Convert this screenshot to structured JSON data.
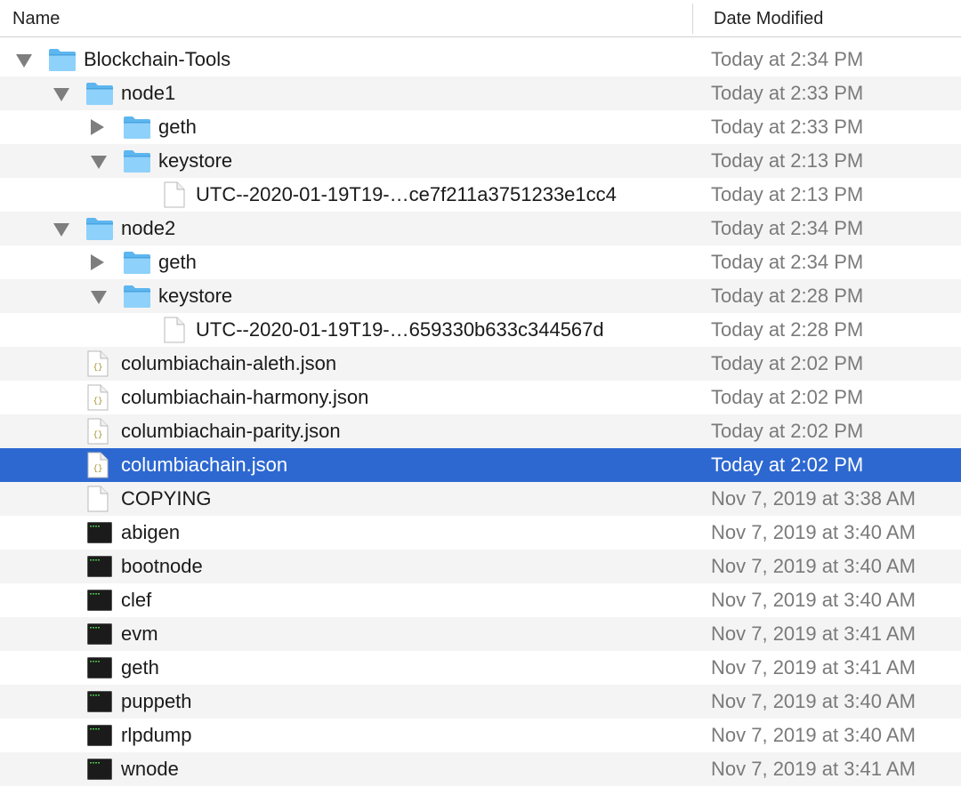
{
  "header": {
    "name_label": "Name",
    "date_label": "Date Modified"
  },
  "rows": [
    {
      "name": "Blockchain-Tools",
      "date": "Today at 2:34 PM",
      "icon": "folder-icon",
      "disclosure": "expanded"
    },
    {
      "name": "node1",
      "date": "Today at 2:33 PM",
      "icon": "folder-icon",
      "disclosure": "expanded"
    },
    {
      "name": "geth",
      "date": "Today at 2:33 PM",
      "icon": "folder-icon",
      "disclosure": "collapsed"
    },
    {
      "name": "keystore",
      "date": "Today at 2:13 PM",
      "icon": "folder-icon",
      "disclosure": "expanded"
    },
    {
      "name": "UTC--2020-01-19T19-…ce7f211a3751233e1cc4",
      "date": "Today at 2:13 PM",
      "icon": "document-icon"
    },
    {
      "name": "node2",
      "date": "Today at 2:34 PM",
      "icon": "folder-icon",
      "disclosure": "expanded"
    },
    {
      "name": "geth",
      "date": "Today at 2:34 PM",
      "icon": "folder-icon",
      "disclosure": "collapsed"
    },
    {
      "name": "keystore",
      "date": "Today at 2:28 PM",
      "icon": "folder-icon",
      "disclosure": "expanded"
    },
    {
      "name": "UTC--2020-01-19T19-…659330b633c344567d",
      "date": "Today at 2:28 PM",
      "icon": "document-icon"
    },
    {
      "name": "columbiachain-aleth.json",
      "date": "Today at 2:02 PM",
      "icon": "json-file-icon"
    },
    {
      "name": "columbiachain-harmony.json",
      "date": "Today at 2:02 PM",
      "icon": "json-file-icon"
    },
    {
      "name": "columbiachain-parity.json",
      "date": "Today at 2:02 PM",
      "icon": "json-file-icon"
    },
    {
      "name": "columbiachain.json",
      "date": "Today at 2:02 PM",
      "icon": "json-file-icon",
      "selected": true
    },
    {
      "name": "COPYING",
      "date": "Nov 7, 2019 at 3:38 AM",
      "icon": "document-icon"
    },
    {
      "name": "abigen",
      "date": "Nov 7, 2019 at 3:40 AM",
      "icon": "terminal-exec-icon"
    },
    {
      "name": "bootnode",
      "date": "Nov 7, 2019 at 3:40 AM",
      "icon": "terminal-exec-icon"
    },
    {
      "name": "clef",
      "date": "Nov 7, 2019 at 3:40 AM",
      "icon": "terminal-exec-icon"
    },
    {
      "name": "evm",
      "date": "Nov 7, 2019 at 3:41 AM",
      "icon": "terminal-exec-icon"
    },
    {
      "name": "geth",
      "date": "Nov 7, 2019 at 3:41 AM",
      "icon": "terminal-exec-icon"
    },
    {
      "name": "puppeth",
      "date": "Nov 7, 2019 at 3:40 AM",
      "icon": "terminal-exec-icon"
    },
    {
      "name": "rlpdump",
      "date": "Nov 7, 2019 at 3:40 AM",
      "icon": "terminal-exec-icon"
    },
    {
      "name": "wnode",
      "date": "Nov 7, 2019 at 3:41 AM",
      "icon": "terminal-exec-icon"
    }
  ],
  "colors": {
    "selection": "#2d68d1",
    "stripe": "#f4f4f4",
    "folder": "#6cc0f5",
    "date_text": "#7a7a7a"
  }
}
